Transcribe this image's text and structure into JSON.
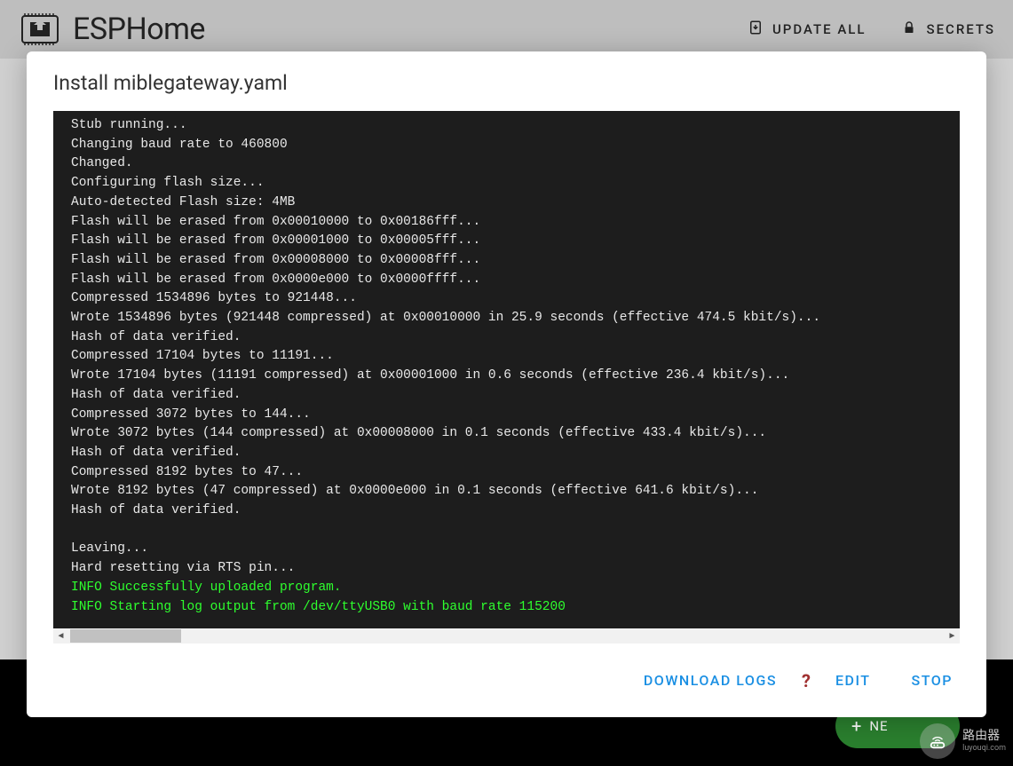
{
  "header": {
    "app_name": "ESPHome",
    "update_all_label": "UPDATE ALL",
    "secrets_label": "SECRETS"
  },
  "dialog": {
    "title": "Install miblegateway.yaml",
    "log_lines": [
      {
        "text": "Stub running...",
        "class": ""
      },
      {
        "text": "Changing baud rate to 460800",
        "class": ""
      },
      {
        "text": "Changed.",
        "class": ""
      },
      {
        "text": "Configuring flash size...",
        "class": ""
      },
      {
        "text": "Auto-detected Flash size: 4MB",
        "class": ""
      },
      {
        "text": "Flash will be erased from 0x00010000 to 0x00186fff...",
        "class": ""
      },
      {
        "text": "Flash will be erased from 0x00001000 to 0x00005fff...",
        "class": ""
      },
      {
        "text": "Flash will be erased from 0x00008000 to 0x00008fff...",
        "class": ""
      },
      {
        "text": "Flash will be erased from 0x0000e000 to 0x0000ffff...",
        "class": ""
      },
      {
        "text": "Compressed 1534896 bytes to 921448...",
        "class": ""
      },
      {
        "text": "Wrote 1534896 bytes (921448 compressed) at 0x00010000 in 25.9 seconds (effective 474.5 kbit/s)...",
        "class": ""
      },
      {
        "text": "Hash of data verified.",
        "class": ""
      },
      {
        "text": "Compressed 17104 bytes to 11191...",
        "class": ""
      },
      {
        "text": "Wrote 17104 bytes (11191 compressed) at 0x00001000 in 0.6 seconds (effective 236.4 kbit/s)...",
        "class": ""
      },
      {
        "text": "Hash of data verified.",
        "class": ""
      },
      {
        "text": "Compressed 3072 bytes to 144...",
        "class": ""
      },
      {
        "text": "Wrote 3072 bytes (144 compressed) at 0x00008000 in 0.1 seconds (effective 433.4 kbit/s)...",
        "class": ""
      },
      {
        "text": "Hash of data verified.",
        "class": ""
      },
      {
        "text": "Compressed 8192 bytes to 47...",
        "class": ""
      },
      {
        "text": "Wrote 8192 bytes (47 compressed) at 0x0000e000 in 0.1 seconds (effective 641.6 kbit/s)...",
        "class": ""
      },
      {
        "text": "Hash of data verified.",
        "class": ""
      },
      {
        "text": "",
        "class": ""
      },
      {
        "text": "Leaving...",
        "class": ""
      },
      {
        "text": "Hard resetting via RTS pin...",
        "class": ""
      },
      {
        "text": "INFO Successfully uploaded program.",
        "class": "info"
      },
      {
        "text": "INFO Starting log output from /dev/ttyUSB0 with baud rate 115200",
        "class": "info"
      }
    ],
    "download_logs_label": "DOWNLOAD LOGS",
    "edit_label": "EDIT",
    "stop_label": "STOP",
    "help_glyph": "?"
  },
  "fab": {
    "label": "NE"
  },
  "watermark": {
    "line1": "路由器",
    "line2": "luyouqi.com"
  }
}
